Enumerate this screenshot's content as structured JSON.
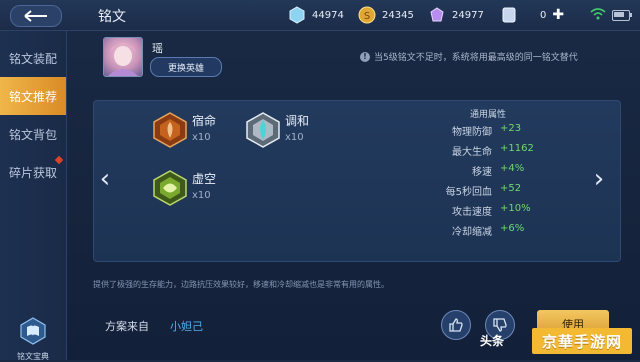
{
  "header": {
    "title": "铭文",
    "currencies": [
      {
        "icon": "diamond-icon",
        "value": "44974"
      },
      {
        "icon": "gold-coin-icon",
        "value": "24345"
      },
      {
        "icon": "crystal-icon",
        "value": "24977"
      },
      {
        "icon": "ticket-icon",
        "value": "0"
      }
    ]
  },
  "sidebar": {
    "items": [
      {
        "label": "铭文装配"
      },
      {
        "label": "铭文推荐"
      },
      {
        "label": "铭文背包"
      },
      {
        "label": "碎片获取"
      }
    ],
    "codex_label": "铭文宝典"
  },
  "hero": {
    "name": "瑶",
    "change_label": "更换英雄"
  },
  "notice": "当5级铭文不足时，系统将用最高级的同一铭文替代",
  "runes": [
    {
      "name": "宿命",
      "count": "x10",
      "color": "#c4621e"
    },
    {
      "name": "调和",
      "count": "x10",
      "color": "#d9dde3"
    },
    {
      "name": "虚空",
      "count": "x10",
      "color": "#7aa92e"
    }
  ],
  "attributes": {
    "title": "通用属性",
    "rows": [
      {
        "key": "物理防御",
        "value": "+23"
      },
      {
        "key": "最大生命",
        "value": "+1162"
      },
      {
        "key": "移速",
        "value": "+4%"
      },
      {
        "key": "每5秒回血",
        "value": "+52"
      },
      {
        "key": "攻击速度",
        "value": "+10%"
      },
      {
        "key": "冷却缩减",
        "value": "+6%"
      }
    ]
  },
  "description": "提供了极强的生存能力，边路抗压效果较好，移速和冷却缩减也是非常有用的属性。",
  "source": {
    "label": "方案来自",
    "value": "小妲己"
  },
  "use_label": "使用",
  "watermark": {
    "left": "头条",
    "right": "京華手游网"
  }
}
